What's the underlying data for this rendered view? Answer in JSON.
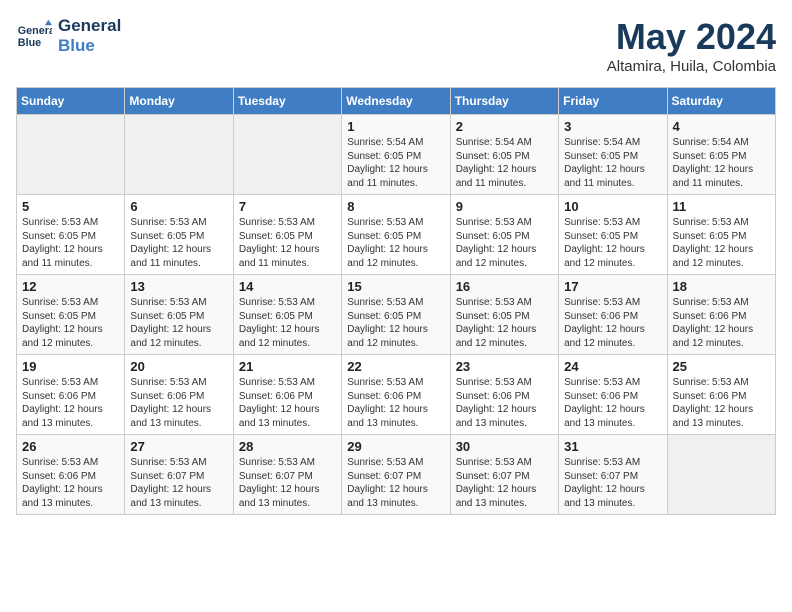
{
  "logo": {
    "line1": "General",
    "line2": "Blue"
  },
  "title": "May 2024",
  "subtitle": "Altamira, Huila, Colombia",
  "weekdays": [
    "Sunday",
    "Monday",
    "Tuesday",
    "Wednesday",
    "Thursday",
    "Friday",
    "Saturday"
  ],
  "weeks": [
    [
      {
        "day": "",
        "sunrise": "",
        "sunset": "",
        "daylight": ""
      },
      {
        "day": "",
        "sunrise": "",
        "sunset": "",
        "daylight": ""
      },
      {
        "day": "",
        "sunrise": "",
        "sunset": "",
        "daylight": ""
      },
      {
        "day": "1",
        "sunrise": "Sunrise: 5:54 AM",
        "sunset": "Sunset: 6:05 PM",
        "daylight": "Daylight: 12 hours and 11 minutes."
      },
      {
        "day": "2",
        "sunrise": "Sunrise: 5:54 AM",
        "sunset": "Sunset: 6:05 PM",
        "daylight": "Daylight: 12 hours and 11 minutes."
      },
      {
        "day": "3",
        "sunrise": "Sunrise: 5:54 AM",
        "sunset": "Sunset: 6:05 PM",
        "daylight": "Daylight: 12 hours and 11 minutes."
      },
      {
        "day": "4",
        "sunrise": "Sunrise: 5:54 AM",
        "sunset": "Sunset: 6:05 PM",
        "daylight": "Daylight: 12 hours and 11 minutes."
      }
    ],
    [
      {
        "day": "5",
        "sunrise": "Sunrise: 5:53 AM",
        "sunset": "Sunset: 6:05 PM",
        "daylight": "Daylight: 12 hours and 11 minutes."
      },
      {
        "day": "6",
        "sunrise": "Sunrise: 5:53 AM",
        "sunset": "Sunset: 6:05 PM",
        "daylight": "Daylight: 12 hours and 11 minutes."
      },
      {
        "day": "7",
        "sunrise": "Sunrise: 5:53 AM",
        "sunset": "Sunset: 6:05 PM",
        "daylight": "Daylight: 12 hours and 11 minutes."
      },
      {
        "day": "8",
        "sunrise": "Sunrise: 5:53 AM",
        "sunset": "Sunset: 6:05 PM",
        "daylight": "Daylight: 12 hours and 12 minutes."
      },
      {
        "day": "9",
        "sunrise": "Sunrise: 5:53 AM",
        "sunset": "Sunset: 6:05 PM",
        "daylight": "Daylight: 12 hours and 12 minutes."
      },
      {
        "day": "10",
        "sunrise": "Sunrise: 5:53 AM",
        "sunset": "Sunset: 6:05 PM",
        "daylight": "Daylight: 12 hours and 12 minutes."
      },
      {
        "day": "11",
        "sunrise": "Sunrise: 5:53 AM",
        "sunset": "Sunset: 6:05 PM",
        "daylight": "Daylight: 12 hours and 12 minutes."
      }
    ],
    [
      {
        "day": "12",
        "sunrise": "Sunrise: 5:53 AM",
        "sunset": "Sunset: 6:05 PM",
        "daylight": "Daylight: 12 hours and 12 minutes."
      },
      {
        "day": "13",
        "sunrise": "Sunrise: 5:53 AM",
        "sunset": "Sunset: 6:05 PM",
        "daylight": "Daylight: 12 hours and 12 minutes."
      },
      {
        "day": "14",
        "sunrise": "Sunrise: 5:53 AM",
        "sunset": "Sunset: 6:05 PM",
        "daylight": "Daylight: 12 hours and 12 minutes."
      },
      {
        "day": "15",
        "sunrise": "Sunrise: 5:53 AM",
        "sunset": "Sunset: 6:05 PM",
        "daylight": "Daylight: 12 hours and 12 minutes."
      },
      {
        "day": "16",
        "sunrise": "Sunrise: 5:53 AM",
        "sunset": "Sunset: 6:05 PM",
        "daylight": "Daylight: 12 hours and 12 minutes."
      },
      {
        "day": "17",
        "sunrise": "Sunrise: 5:53 AM",
        "sunset": "Sunset: 6:06 PM",
        "daylight": "Daylight: 12 hours and 12 minutes."
      },
      {
        "day": "18",
        "sunrise": "Sunrise: 5:53 AM",
        "sunset": "Sunset: 6:06 PM",
        "daylight": "Daylight: 12 hours and 12 minutes."
      }
    ],
    [
      {
        "day": "19",
        "sunrise": "Sunrise: 5:53 AM",
        "sunset": "Sunset: 6:06 PM",
        "daylight": "Daylight: 12 hours and 13 minutes."
      },
      {
        "day": "20",
        "sunrise": "Sunrise: 5:53 AM",
        "sunset": "Sunset: 6:06 PM",
        "daylight": "Daylight: 12 hours and 13 minutes."
      },
      {
        "day": "21",
        "sunrise": "Sunrise: 5:53 AM",
        "sunset": "Sunset: 6:06 PM",
        "daylight": "Daylight: 12 hours and 13 minutes."
      },
      {
        "day": "22",
        "sunrise": "Sunrise: 5:53 AM",
        "sunset": "Sunset: 6:06 PM",
        "daylight": "Daylight: 12 hours and 13 minutes."
      },
      {
        "day": "23",
        "sunrise": "Sunrise: 5:53 AM",
        "sunset": "Sunset: 6:06 PM",
        "daylight": "Daylight: 12 hours and 13 minutes."
      },
      {
        "day": "24",
        "sunrise": "Sunrise: 5:53 AM",
        "sunset": "Sunset: 6:06 PM",
        "daylight": "Daylight: 12 hours and 13 minutes."
      },
      {
        "day": "25",
        "sunrise": "Sunrise: 5:53 AM",
        "sunset": "Sunset: 6:06 PM",
        "daylight": "Daylight: 12 hours and 13 minutes."
      }
    ],
    [
      {
        "day": "26",
        "sunrise": "Sunrise: 5:53 AM",
        "sunset": "Sunset: 6:06 PM",
        "daylight": "Daylight: 12 hours and 13 minutes."
      },
      {
        "day": "27",
        "sunrise": "Sunrise: 5:53 AM",
        "sunset": "Sunset: 6:07 PM",
        "daylight": "Daylight: 12 hours and 13 minutes."
      },
      {
        "day": "28",
        "sunrise": "Sunrise: 5:53 AM",
        "sunset": "Sunset: 6:07 PM",
        "daylight": "Daylight: 12 hours and 13 minutes."
      },
      {
        "day": "29",
        "sunrise": "Sunrise: 5:53 AM",
        "sunset": "Sunset: 6:07 PM",
        "daylight": "Daylight: 12 hours and 13 minutes."
      },
      {
        "day": "30",
        "sunrise": "Sunrise: 5:53 AM",
        "sunset": "Sunset: 6:07 PM",
        "daylight": "Daylight: 12 hours and 13 minutes."
      },
      {
        "day": "31",
        "sunrise": "Sunrise: 5:53 AM",
        "sunset": "Sunset: 6:07 PM",
        "daylight": "Daylight: 12 hours and 13 minutes."
      },
      {
        "day": "",
        "sunrise": "",
        "sunset": "",
        "daylight": ""
      }
    ]
  ]
}
